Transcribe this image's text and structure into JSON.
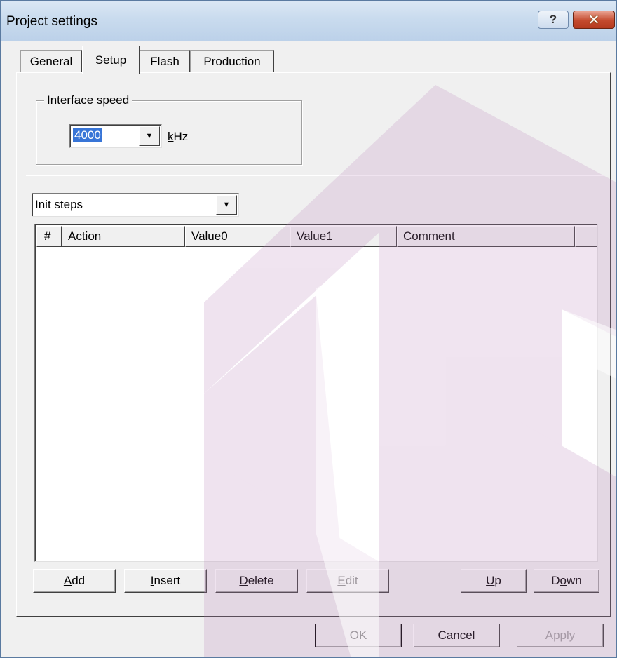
{
  "window": {
    "title": "Project settings",
    "help_glyph": "?",
    "close_glyph": "✕"
  },
  "tabs": [
    {
      "label": "General",
      "active": false
    },
    {
      "label": "Setup",
      "active": true
    },
    {
      "label": "Flash",
      "active": false
    },
    {
      "label": "Production",
      "active": false
    }
  ],
  "interface_speed": {
    "group_label": "Interface speed",
    "value": "4000",
    "unit_accel": "k",
    "unit_rest": "Hz"
  },
  "steps_selector": {
    "value": "Init steps"
  },
  "list": {
    "columns": [
      "#",
      "Action",
      "Value0",
      "Value1",
      "Comment"
    ],
    "rows": []
  },
  "list_buttons": {
    "add": {
      "accel": "A",
      "rest": "dd"
    },
    "insert": {
      "accel": "I",
      "rest": "nsert"
    },
    "delete": {
      "accel": "D",
      "rest": "elete"
    },
    "edit": {
      "accel": "E",
      "rest": "dit"
    },
    "up": {
      "accel": "U",
      "rest": "p"
    },
    "down": {
      "pre": "D",
      "accel": "o",
      "rest": "wn"
    }
  },
  "dialog_buttons": {
    "ok": "OK",
    "cancel": "Cancel",
    "apply_accel": "A",
    "apply_rest": "pply"
  },
  "colors": {
    "selection": "#3875d7",
    "face": "#f0f0f0",
    "watermark": "#c9a6c9"
  },
  "icons": {
    "dropdown": "▼"
  }
}
